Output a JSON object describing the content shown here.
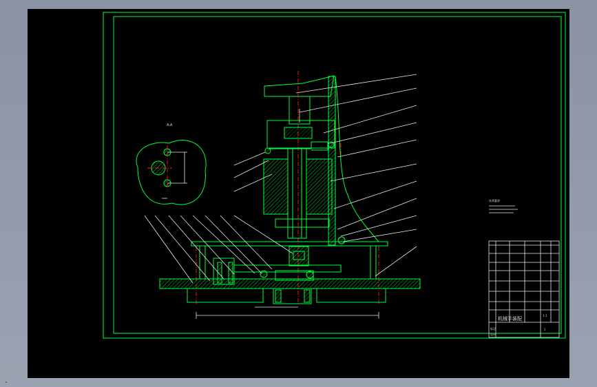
{
  "title_block": {
    "drawing_title": "机械手装配",
    "row_label_1": "标记",
    "row_label_2": "设计",
    "scale_text": "1:1",
    "sheet_text": "1"
  },
  "section_label": "A-A",
  "tech_notes_heading": "技术要求",
  "colors": {
    "frame": "#00ff3c",
    "center_line": "#ff2020",
    "leader": "#e8e8e8",
    "background": "#000000"
  }
}
